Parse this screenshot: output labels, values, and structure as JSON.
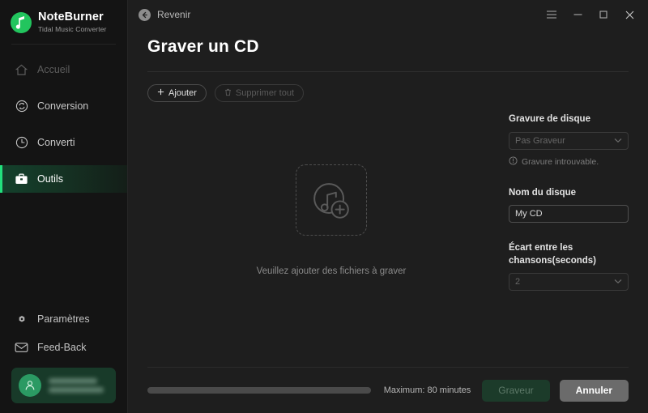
{
  "brand": {
    "name": "NoteBurner",
    "tagline": "Tidal Music Converter",
    "logo_icon": "music-note-icon",
    "accent_color": "#22c55e"
  },
  "sidebar": {
    "items": [
      {
        "label": "Accueil",
        "icon": "home-icon",
        "state": "disabled"
      },
      {
        "label": "Conversion",
        "icon": "convert-refresh-icon",
        "state": "normal"
      },
      {
        "label": "Converti",
        "icon": "clock-history-icon",
        "state": "normal"
      },
      {
        "label": "Outils",
        "icon": "toolbox-icon",
        "state": "active"
      }
    ],
    "bottom_items": [
      {
        "label": "Paramètres",
        "icon": "gear-icon"
      },
      {
        "label": "Feed-Back",
        "icon": "envelope-icon"
      }
    ],
    "account": {
      "avatar_icon": "user-avatar-icon",
      "line1": "",
      "line2": "",
      "blurred": true
    }
  },
  "titlebar": {
    "back_label": "Revenir",
    "back_icon": "back-arrow-icon",
    "menu_icon": "hamburger-menu-icon",
    "minimize_icon": "minimize-icon",
    "maximize_icon": "maximize-icon",
    "close_icon": "close-icon"
  },
  "main": {
    "page_title": "Graver un CD",
    "toolbar": {
      "add_label": "Ajouter",
      "add_icon": "plus-icon",
      "delete_all_label": "Supprimer tout",
      "delete_all_icon": "trash-icon",
      "delete_all_disabled": true
    },
    "dropzone": {
      "icon": "add-music-disc-icon",
      "caption": "Veuillez ajouter des fichiers à graver"
    },
    "right_panel": {
      "burner_label": "Gravure de disque",
      "burner_value": "Pas Graveur",
      "burner_warning": "Gravure introuvable.",
      "warning_icon": "info-alert-icon",
      "disc_name_label": "Nom du disque",
      "disc_name_value": "My CD",
      "disc_name_placeholder": "My CD",
      "gap_label": "Écart entre les chansons(seconds)",
      "gap_value": "2",
      "chevron_icon": "chevron-down-icon"
    }
  },
  "footer": {
    "progress_percent": 0,
    "max_label": "Maximum: 80 minutes",
    "burn_label": "Graveur",
    "burn_disabled": true,
    "cancel_label": "Annuler"
  }
}
